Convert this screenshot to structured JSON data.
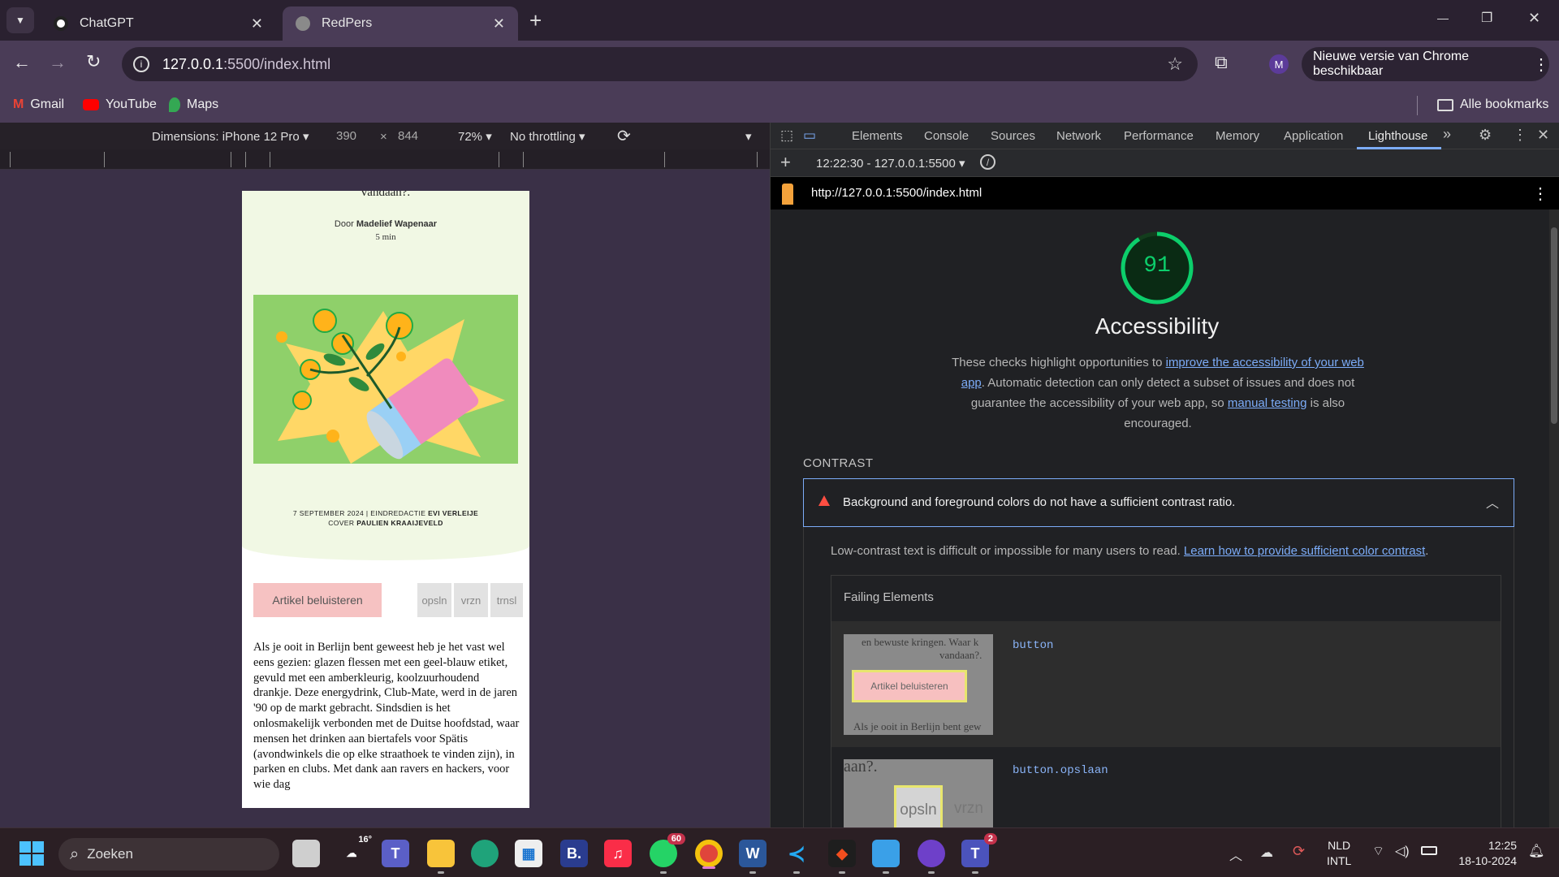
{
  "browser": {
    "tabs": [
      {
        "title": "ChatGPT",
        "close": "✕"
      },
      {
        "title": "RedPers",
        "close": "✕"
      }
    ],
    "new_tab": "+",
    "window_controls": {
      "minimize": "—",
      "restore": "❐",
      "close": "✕"
    },
    "url_host": "127.0.0.1",
    "url_rest": ":5500/index.html",
    "profile_initial": "M",
    "update_text": "Nieuwe versie van Chrome beschikbaar",
    "bookmarks": [
      "Gmail",
      "YouTube",
      "Maps"
    ],
    "all_bookmarks": "Alle bookmarks"
  },
  "device_toolbar": {
    "dimensions": "Dimensions: iPhone 12 Pro",
    "width": "390",
    "times": "×",
    "height": "844",
    "zoom": "72%",
    "throttling": "No throttling"
  },
  "article": {
    "title_fragment": "vandaan?.",
    "byline_prefix": "Door ",
    "author": "Madelief Wapenaar",
    "read_time": "5 min",
    "meta_line1_prefix": "7 SEPTEMBER 2024 | EINDREDACTIE ",
    "meta_line1_name": "EVI VERLEIJE",
    "meta_line2_prefix": "COVER ",
    "meta_line2_name": "PAULIEN KRAAIJEVELD",
    "listen_button": "Artikel beluisteren",
    "small_buttons": [
      "opsln",
      "vrzn",
      "trnsl"
    ],
    "body": "Als je ooit in Berlijn bent geweest heb je het vast wel eens gezien: glazen flessen met een geel-blauw etiket, gevuld met een amberkleurig, koolzuurhoudend drankje. Deze energydrink, Club-Mate, werd in de jaren '90 op de markt gebracht. Sindsdien is het onlosmakelijk verbonden met de Duitse hoofdstad, waar mensen het drinken aan biertafels voor Spätis (avondwinkels die op elke straathoek te vinden zijn), in parken en clubs. Met dank aan ravers en hackers, voor wie dag"
  },
  "devtools": {
    "tabs": [
      "Elements",
      "Console",
      "Sources",
      "Network",
      "Performance",
      "Memory",
      "Application",
      "Lighthouse"
    ],
    "more": "»",
    "report_selector": "12:22:30 - 127.0.0.1:5500 ▾",
    "report_url": "http://127.0.0.1:5500/index.html",
    "score": "91",
    "score_value": 91,
    "category_title": "Accessibility",
    "desc_1": "These checks highlight opportunities to ",
    "desc_link1": "improve the accessibility of your web app",
    "desc_2": ". Automatic detection can only detect a subset of issues and does not guarantee the accessibility of your web app, so ",
    "desc_link2": "manual testing",
    "desc_3": " is also encouraged.",
    "section": "CONTRAST",
    "audit_title": "Background and foreground colors do not have a sufficient contrast ratio.",
    "audit_desc": "Low-contrast text is difficult or impossible for many users to read. ",
    "audit_link": "Learn how to provide sufficient color contrast",
    "audit_desc_end": ".",
    "failing_header": "Failing Elements",
    "failing": [
      {
        "selector": "button",
        "snap_top": "en bewuste kringen. Waar k",
        "snap_top2": "vandaan?.",
        "snap_button": "Artikel beluisteren",
        "snap_bottom": "Als je ooit in Berlijn bent gew"
      },
      {
        "selector": "button.opslaan",
        "snap_top": "aan?.",
        "snap_button": "opsln",
        "snap_other": "vrzn"
      }
    ]
  },
  "taskbar": {
    "search": "Zoeken",
    "weather": "16°",
    "whatsapp_badge": "60",
    "teams_badge": "2",
    "lang1": "NLD",
    "lang2": "INTL",
    "time": "12:25",
    "date": "18-10-2024"
  }
}
